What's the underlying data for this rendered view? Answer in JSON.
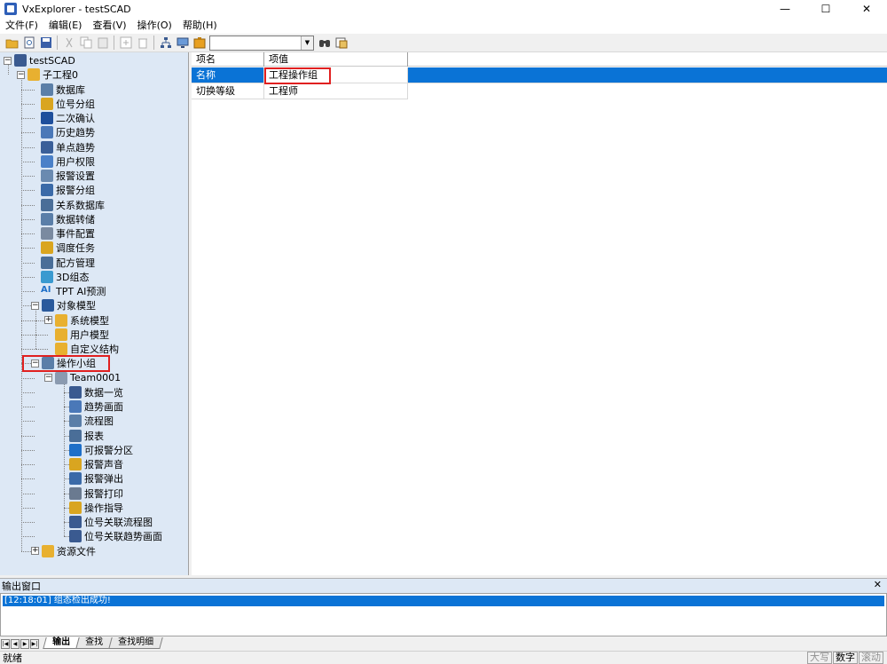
{
  "window": {
    "title": "VxExplorer - testSCAD",
    "minimize": "—",
    "maximize": "☐",
    "close": "✕"
  },
  "menu": [
    "文件(F)",
    "编辑(E)",
    "查看(V)",
    "操作(O)",
    "帮助(H)"
  ],
  "toolbar": {
    "combo_value": "",
    "combo_arrow": "▼"
  },
  "tree": {
    "root": "testSCAD",
    "project": "子工程0",
    "items": [
      {
        "label": "数据库",
        "icon": "database-icon",
        "color": "#5b7fa8"
      },
      {
        "label": "位号分组",
        "icon": "tag-group-icon",
        "color": "#d9a520"
      },
      {
        "label": "二次确认",
        "icon": "checkmark-icon",
        "color": "#1e4f9c"
      },
      {
        "label": "历史趋势",
        "icon": "history-trend-icon",
        "color": "#4a78b8"
      },
      {
        "label": "单点趋势",
        "icon": "single-trend-icon",
        "color": "#3a5f99"
      },
      {
        "label": "用户权限",
        "icon": "user-icon",
        "color": "#4a80c8"
      },
      {
        "label": "报警设置",
        "icon": "alarm-settings-icon",
        "color": "#6a8ab0"
      },
      {
        "label": "报警分组",
        "icon": "alarm-group-icon",
        "color": "#3a6aa8"
      },
      {
        "label": "关系数据库",
        "icon": "relational-db-icon",
        "color": "#4a6e98"
      },
      {
        "label": "数据转储",
        "icon": "data-dump-icon",
        "color": "#5a7ea8"
      },
      {
        "label": "事件配置",
        "icon": "event-config-icon",
        "color": "#7a8aa0"
      },
      {
        "label": "调度任务",
        "icon": "schedule-icon",
        "color": "#d9a520"
      },
      {
        "label": "配方管理",
        "icon": "recipe-icon",
        "color": "#4a6e98"
      },
      {
        "label": "3D组态",
        "icon": "cube-3d-icon",
        "color": "#3a9ad0"
      },
      {
        "label": "TPT AI预测",
        "icon": "ai-icon",
        "color": "#1e6fc8"
      }
    ],
    "object_model": {
      "label": "对象模型",
      "children": [
        "系统模型",
        "用户模型",
        "自定义结构"
      ]
    },
    "op_group": {
      "label": "操作小组",
      "team": "Team0001",
      "children": [
        {
          "label": "数据一览",
          "icon": "data-overview-icon"
        },
        {
          "label": "趋势画面",
          "icon": "trend-screen-icon"
        },
        {
          "label": "流程图",
          "icon": "flowchart-icon"
        },
        {
          "label": "报表",
          "icon": "report-icon"
        },
        {
          "label": "可报警分区",
          "icon": "alarm-zone-icon"
        },
        {
          "label": "报警声音",
          "icon": "alarm-sound-icon"
        },
        {
          "label": "报警弹出",
          "icon": "alarm-popup-icon"
        },
        {
          "label": "报警打印",
          "icon": "alarm-print-icon"
        },
        {
          "label": "操作指导",
          "icon": "operation-guide-icon"
        },
        {
          "label": "位号关联流程图",
          "icon": "tag-flowchart-icon"
        },
        {
          "label": "位号关联趋势画面",
          "icon": "tag-trend-icon"
        }
      ]
    },
    "resources": "资源文件"
  },
  "grid": {
    "columns": [
      "项名",
      "项值"
    ],
    "rows": [
      {
        "name": "名称",
        "value": "工程操作组"
      },
      {
        "name": "切换等级",
        "value": "工程师"
      }
    ]
  },
  "output": {
    "title": "输出窗口",
    "close": "✕",
    "lines": [
      "[12:18:01] 组态检出成功!"
    ],
    "tabs": [
      "输出",
      "查找",
      "查找明细"
    ]
  },
  "status": {
    "text": "就绪",
    "indicators": [
      "大写",
      "数字",
      "滚动"
    ]
  },
  "colors": {
    "selection": "#0a73d6",
    "tree_bg": "#dde8f5",
    "highlight_box": "#e02020"
  }
}
